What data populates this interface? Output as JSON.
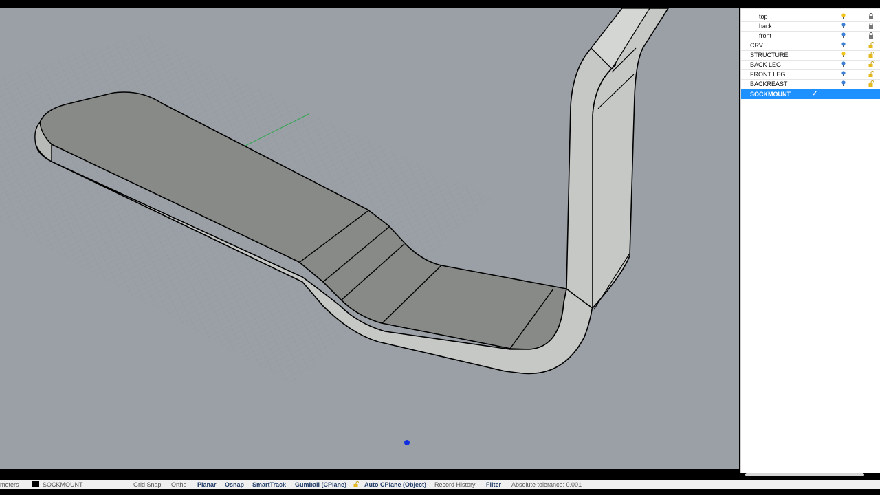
{
  "layers_panel": {
    "rows": [
      {
        "name": "top",
        "bulb_color": "#f2c318",
        "lock_state": "locked"
      },
      {
        "name": "back",
        "bulb_color": "#3b7fd6",
        "lock_state": "locked"
      },
      {
        "name": "front",
        "bulb_color": "#3b7fd6",
        "lock_state": "locked"
      },
      {
        "name": "CRV",
        "bulb_color": "#3b7fd6",
        "lock_state": "unlocked"
      },
      {
        "name": "STRUCTURE",
        "bulb_color": "#f2c318",
        "lock_state": "unlocked"
      },
      {
        "name": "BACK LEG",
        "bulb_color": "#3b7fd6",
        "lock_state": "unlocked"
      },
      {
        "name": "FRONT LEG",
        "bulb_color": "#3b7fd6",
        "lock_state": "unlocked"
      },
      {
        "name": "BACKREAST",
        "bulb_color": "#3b7fd6",
        "lock_state": "unlocked"
      }
    ],
    "current_layer": {
      "name": "SOCKMOUNT",
      "check": "✓"
    },
    "selection_color": "#1e90ff"
  },
  "statusbar": {
    "units": "meters",
    "current_layer": "SOCKMOUNT",
    "grid_snap": "Grid Snap",
    "ortho": "Ortho",
    "planar": "Planar",
    "osnap": "Osnap",
    "smarttrack": "SmartTrack",
    "gumball": "Gumball (CPlane)",
    "auto_cplane": "Auto CPlane (Object)",
    "record_history": "Record History",
    "filter": "Filter",
    "tolerance": "Absolute tolerance: 0.001"
  },
  "viewport": {
    "background": "#9aa0a6",
    "object_color": "#c6c8c6",
    "shaded_face_color": "#878a87"
  }
}
